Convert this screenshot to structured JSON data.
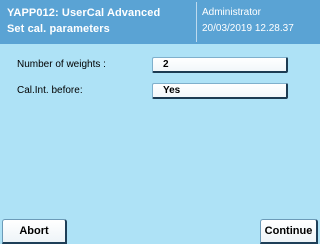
{
  "header": {
    "app_title": "YAPP012: UserCal Advanced",
    "subtitle": "Set cal. parameters",
    "user": "Administrator",
    "datetime": "20/03/2019 12.28.37"
  },
  "parameters": [
    {
      "label": "Number of weights :",
      "value": "2"
    },
    {
      "label": "Cal.Int. before:",
      "value": "Yes"
    }
  ],
  "buttons": {
    "abort": "Abort",
    "continue": "Continue"
  },
  "colors": {
    "header_bg": "#5aa3d4",
    "screen_bg": "#aee2f6"
  }
}
